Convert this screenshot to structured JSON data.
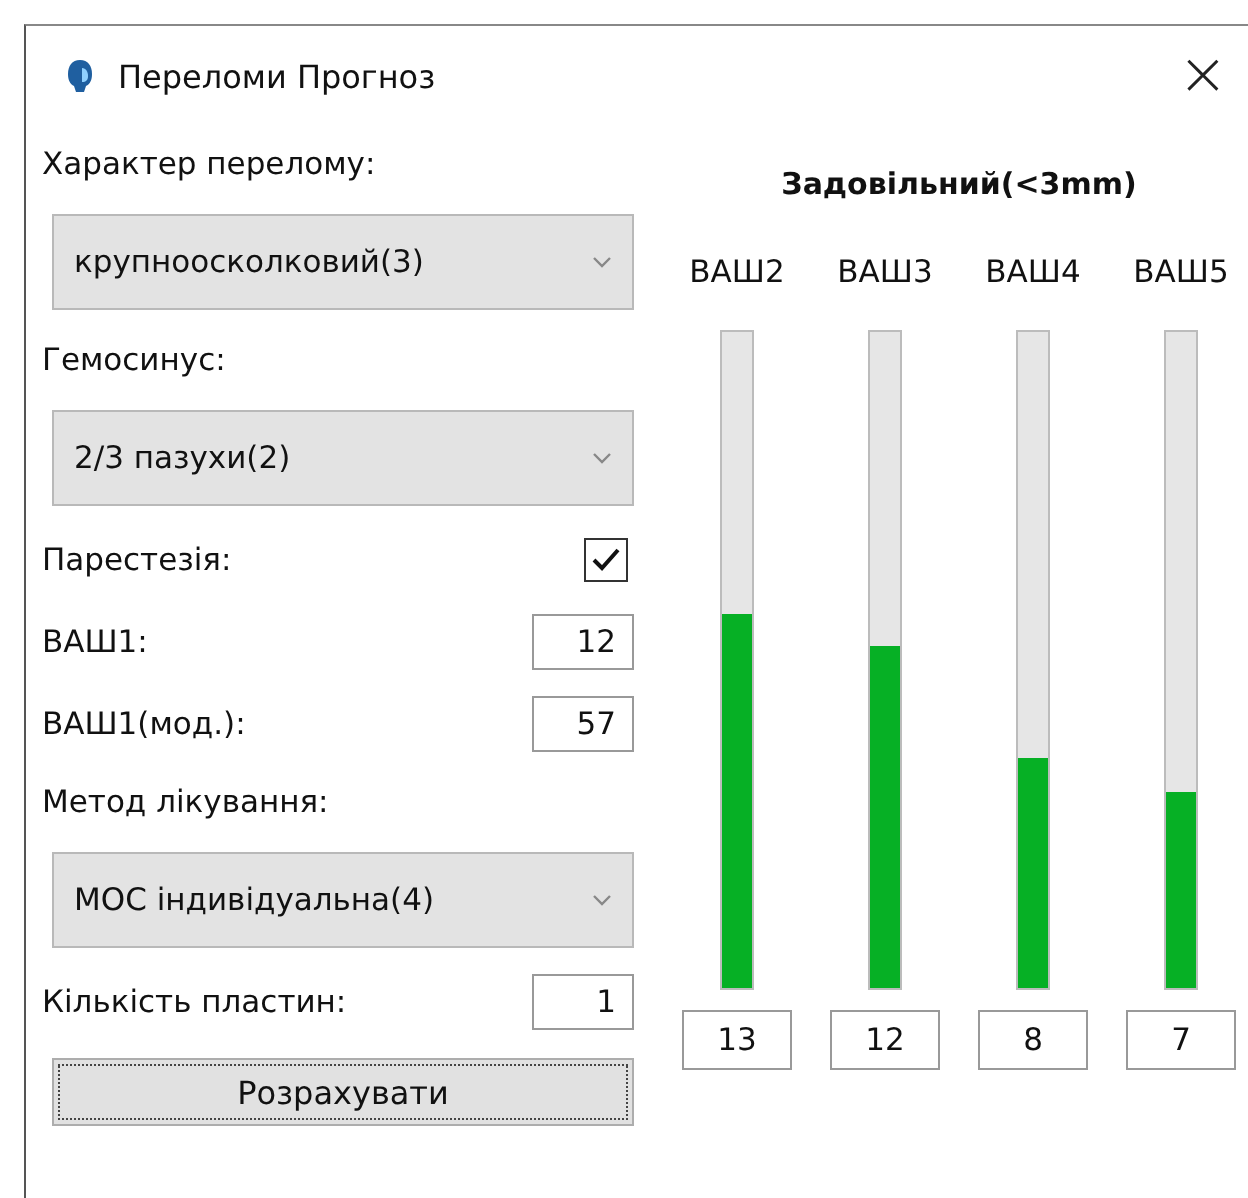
{
  "window": {
    "title": "Переломи Прогноз",
    "close": "×"
  },
  "form": [
    {
      "kind": "label",
      "text": "Характер перелому:"
    },
    {
      "kind": "select",
      "value": "крупноосколковий(3)"
    },
    {
      "kind": "label",
      "text": "Гемосинус:"
    },
    {
      "kind": "select",
      "value": "2/3 пазухи(2)"
    },
    {
      "kind": "check",
      "label": "Парестезія:",
      "checked": true
    },
    {
      "kind": "input",
      "label": "ВАШ1:",
      "value": "12"
    },
    {
      "kind": "input",
      "label": "ВАШ1(мод.):",
      "value": "57"
    },
    {
      "kind": "label",
      "text": "Метод лікування:"
    },
    {
      "kind": "select",
      "value": "МОС індивідуальна(4)"
    },
    {
      "kind": "input",
      "label": "Кількість пластин:",
      "value": "1"
    }
  ],
  "button": "Розрахувати",
  "result": {
    "title": "Задовільний(<3mm)",
    "bars": [
      {
        "label": "ВАШ2",
        "level": 0.57,
        "value": "13"
      },
      {
        "label": "ВАШ3",
        "level": 0.52,
        "value": "12"
      },
      {
        "label": "ВАШ4",
        "level": 0.35,
        "value": "8"
      },
      {
        "label": "ВАШ5",
        "level": 0.3,
        "value": "7"
      }
    ]
  }
}
